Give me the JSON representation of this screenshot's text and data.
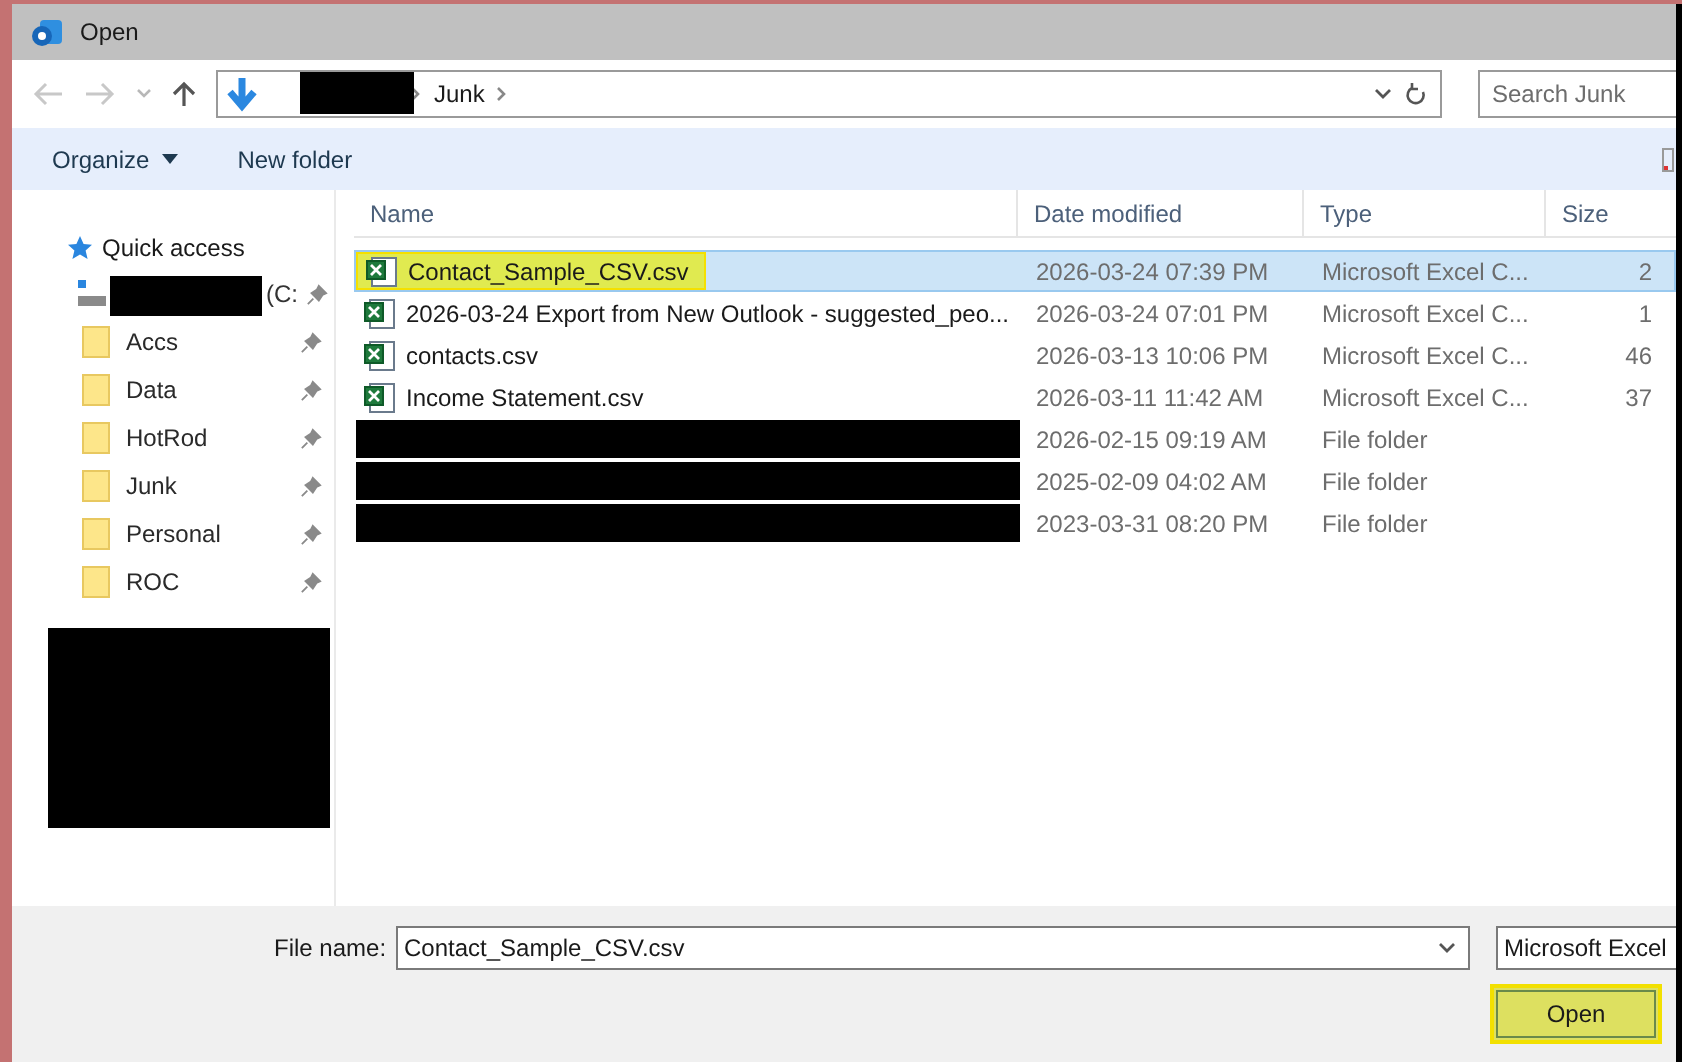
{
  "window": {
    "title": "Open"
  },
  "address": {
    "crumbs": [
      {
        "label": "Junk"
      }
    ]
  },
  "search": {
    "placeholder": "Search Junk"
  },
  "toolbar": {
    "organize": "Organize",
    "new_folder": "New folder"
  },
  "sidebar": {
    "quick_access": "Quick access",
    "drive_suffix": "(C:",
    "items": [
      {
        "label": "Accs"
      },
      {
        "label": "Data"
      },
      {
        "label": "HotRod"
      },
      {
        "label": "Junk"
      },
      {
        "label": "Personal"
      },
      {
        "label": "ROC"
      }
    ]
  },
  "table": {
    "columns": [
      "Name",
      "Date modified",
      "Type",
      "Size"
    ],
    "rows": [
      {
        "kind": "file",
        "name": "Contact_Sample_CSV.csv",
        "date": "2026-03-24 07:39 PM",
        "type": "Microsoft Excel C...",
        "size": "2",
        "selected": true,
        "highlighted": true
      },
      {
        "kind": "file",
        "name": "2026-03-24 Export from New Outlook - suggested_peo...",
        "date": "2026-03-24 07:01 PM",
        "type": "Microsoft Excel C...",
        "size": "1",
        "selected": false,
        "highlighted": false
      },
      {
        "kind": "file",
        "name": "contacts.csv",
        "date": "2026-03-13 10:06 PM",
        "type": "Microsoft Excel C...",
        "size": "46",
        "selected": false,
        "highlighted": false
      },
      {
        "kind": "file",
        "name": "Income Statement.csv",
        "date": "2026-03-11 11:42 AM",
        "type": "Microsoft Excel C...",
        "size": "37",
        "selected": false,
        "highlighted": false
      },
      {
        "kind": "folder",
        "date": "2026-02-15 09:19 AM",
        "type": "File folder",
        "selected": false
      },
      {
        "kind": "folder",
        "date": "2025-02-09 04:02 AM",
        "type": "File folder",
        "selected": false
      },
      {
        "kind": "folder",
        "date": "2023-03-31 08:20 PM",
        "type": "File folder",
        "selected": false
      }
    ]
  },
  "footer": {
    "file_name_label": "File name:",
    "file_name": "Contact_Sample_CSV.csv",
    "file_type": "Microsoft Excel",
    "open_button": {
      "label": "Open",
      "highlighted": true
    }
  }
}
